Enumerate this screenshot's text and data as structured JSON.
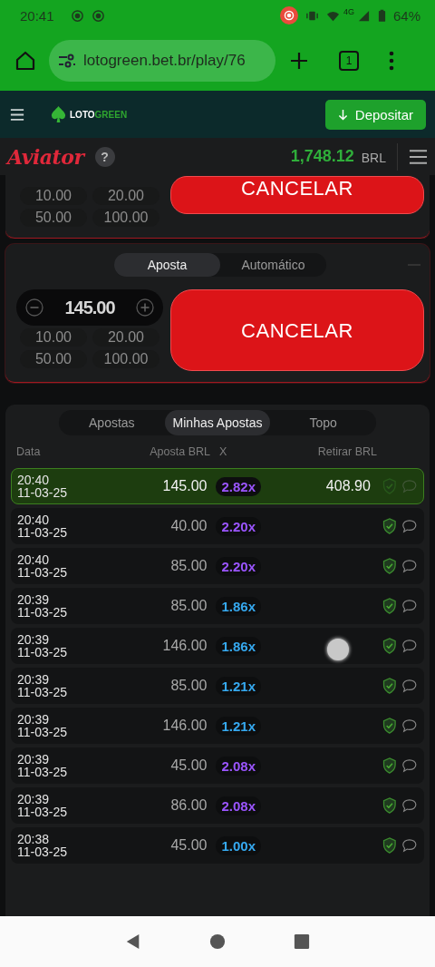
{
  "status_bar": {
    "time": "20:41",
    "network": "4G",
    "battery": "64%"
  },
  "browser": {
    "url": "lotogreen.bet.br/play/76",
    "tab_count": "1"
  },
  "site_header": {
    "logo": {
      "text": "LOTO",
      "accent": "GREEN"
    },
    "deposit_button": "Depositar"
  },
  "game_bar": {
    "title": "Aviator",
    "help": "?",
    "balance": "1,748.12",
    "currency": "BRL"
  },
  "bet_panel_top": {
    "chips": [
      "10.00",
      "20.00",
      "50.00",
      "100.00"
    ],
    "button": "CANCELAR"
  },
  "bet_panel": {
    "tabs": [
      {
        "label": "Aposta",
        "selected": true
      },
      {
        "label": "Automático",
        "selected": false
      }
    ],
    "amount": "145.00",
    "chips": [
      "10.00",
      "20.00",
      "50.00",
      "100.00"
    ],
    "button": "CANCELAR"
  },
  "history": {
    "tabs": [
      {
        "label": "Apostas",
        "selected": false
      },
      {
        "label": "Minhas Apostas",
        "selected": true
      },
      {
        "label": "Topo",
        "selected": false
      }
    ],
    "columns": [
      "Data",
      "Aposta BRL",
      "X",
      "Retirar BRL"
    ],
    "rows": [
      {
        "time": "20:40",
        "date": "11-03-25",
        "bet": "145.00",
        "multiplier": "2.82x",
        "color": "#9b55ff",
        "cashout": "408.90",
        "won": true
      },
      {
        "time": "20:40",
        "date": "11-03-25",
        "bet": "40.00",
        "multiplier": "2.20x",
        "color": "#9b55ff",
        "won": false
      },
      {
        "time": "20:40",
        "date": "11-03-25",
        "bet": "85.00",
        "multiplier": "2.20x",
        "color": "#9b55ff",
        "won": false
      },
      {
        "time": "20:39",
        "date": "11-03-25",
        "bet": "85.00",
        "multiplier": "1.86x",
        "color": "#36a9f0",
        "won": false
      },
      {
        "time": "20:39",
        "date": "11-03-25",
        "bet": "146.00",
        "multiplier": "1.86x",
        "color": "#36a9f0",
        "won": false
      },
      {
        "time": "20:39",
        "date": "11-03-25",
        "bet": "85.00",
        "multiplier": "1.21x",
        "color": "#36a9f0",
        "won": false
      },
      {
        "time": "20:39",
        "date": "11-03-25",
        "bet": "146.00",
        "multiplier": "1.21x",
        "color": "#36a9f0",
        "won": false
      },
      {
        "time": "20:39",
        "date": "11-03-25",
        "bet": "45.00",
        "multiplier": "2.08x",
        "color": "#9b55ff",
        "won": false
      },
      {
        "time": "20:39",
        "date": "11-03-25",
        "bet": "86.00",
        "multiplier": "2.08x",
        "color": "#9b55ff",
        "won": false
      },
      {
        "time": "20:38",
        "date": "11-03-25",
        "bet": "45.00",
        "multiplier": "1.00x",
        "color": "#36a9f0",
        "won": false
      }
    ]
  }
}
